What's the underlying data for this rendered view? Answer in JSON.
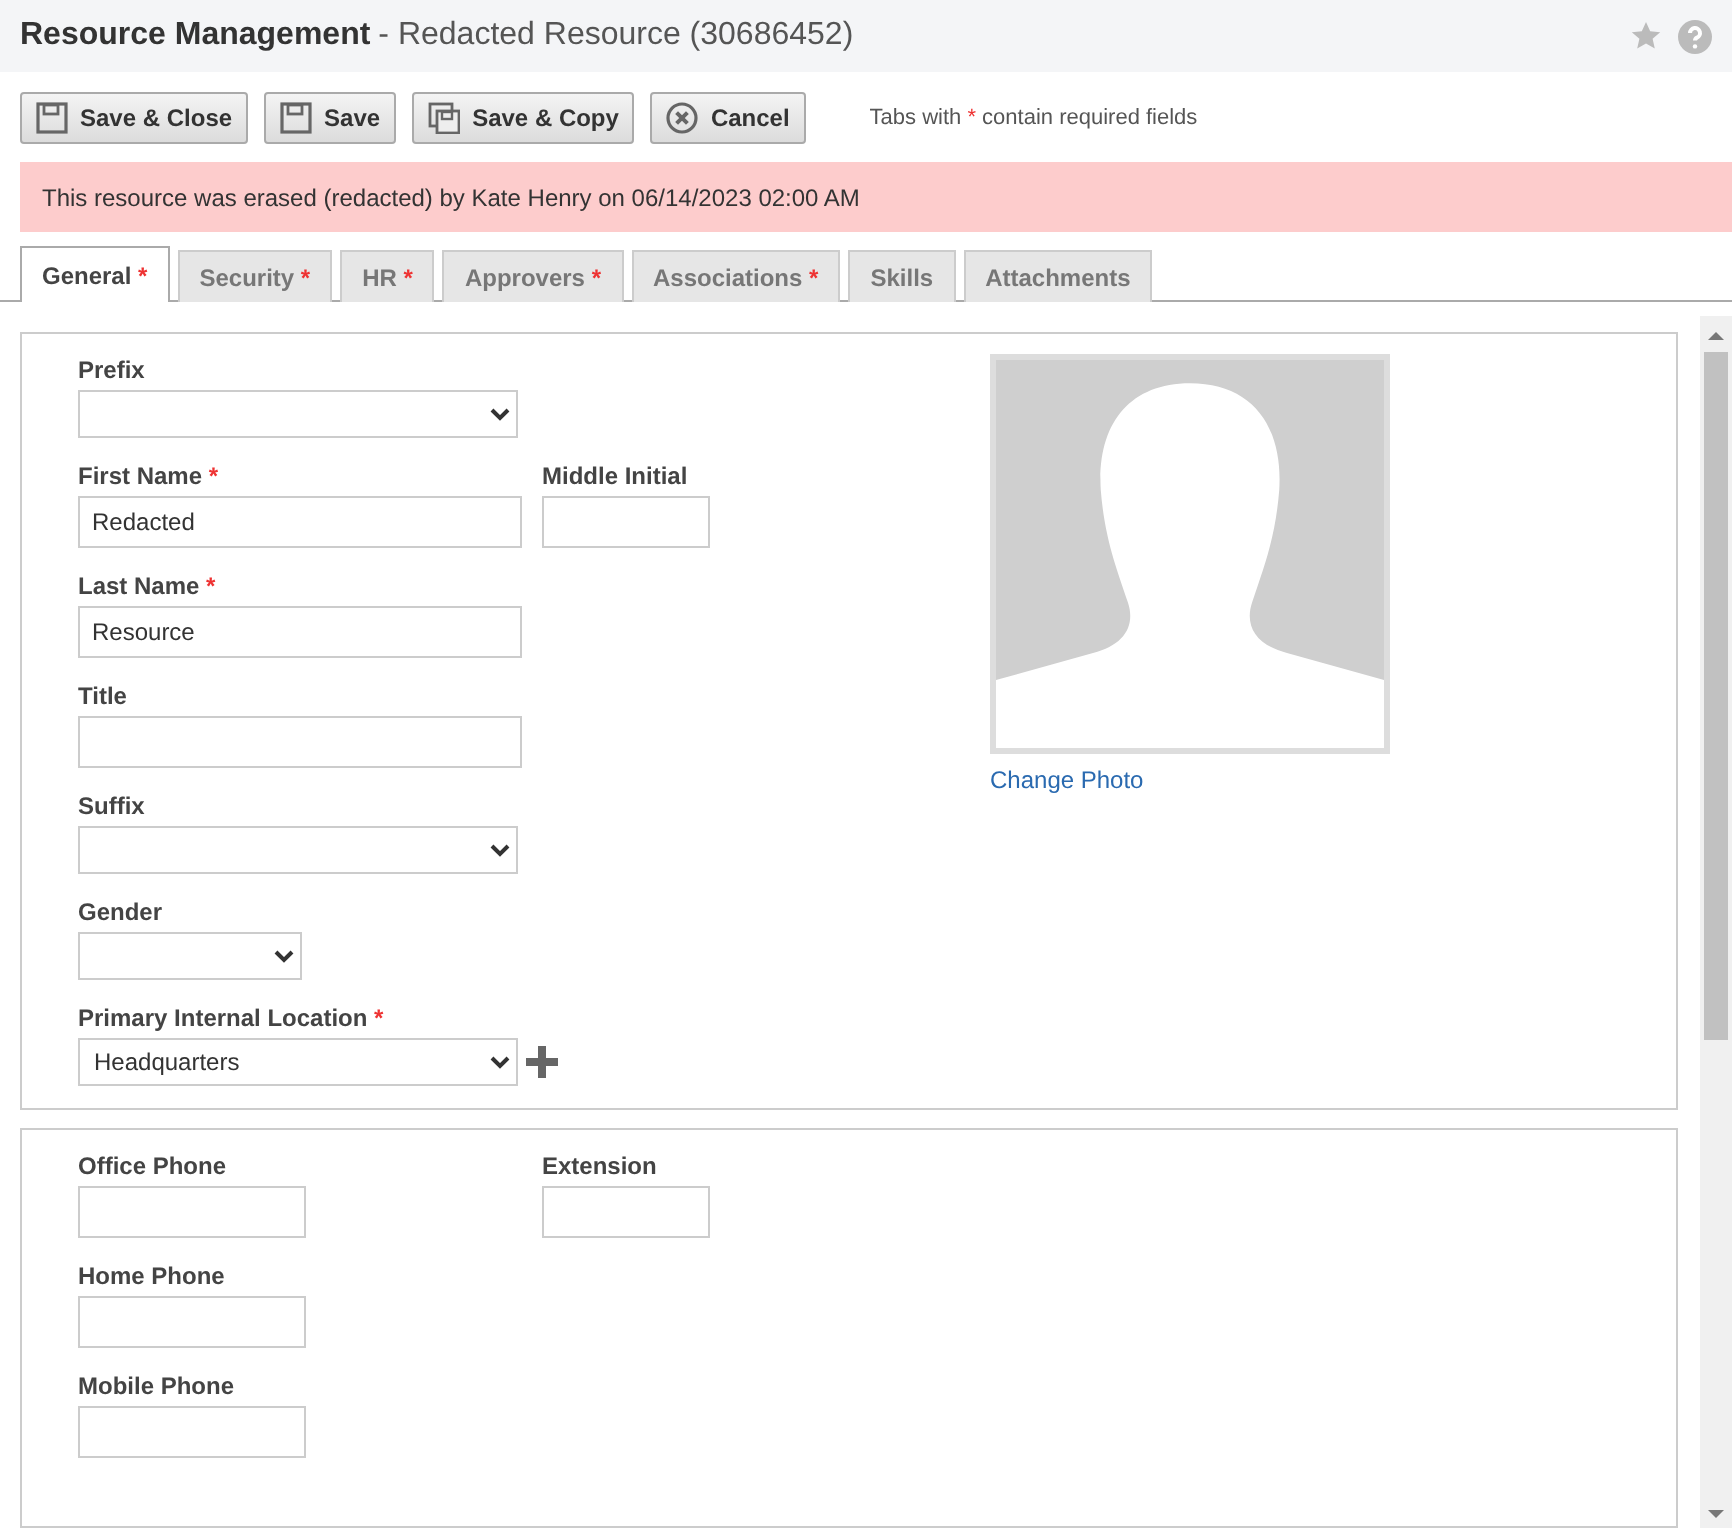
{
  "header": {
    "title": "Resource Management",
    "subtitle": "- Redacted Resource (30686452)"
  },
  "required_mark": "*",
  "toolbar": [
    {
      "label": "Save & Close",
      "kind": "save"
    },
    {
      "label": "Save",
      "kind": "save"
    },
    {
      "label": "Save & Copy",
      "kind": "copy"
    },
    {
      "label": "Cancel",
      "kind": "cancel"
    }
  ],
  "hint": {
    "before": "Tabs with",
    "after": "contain required fields"
  },
  "alert": "This resource was erased (redacted) by Kate Henry on 06/14/2023 02:00 AM",
  "tabs": [
    {
      "label": "General",
      "required": true,
      "selected": true
    },
    {
      "label": "Security",
      "required": true,
      "selected": false
    },
    {
      "label": "HR",
      "required": true,
      "selected": false
    },
    {
      "label": "Approvers",
      "required": true,
      "selected": false
    },
    {
      "label": "Associations",
      "required": true,
      "selected": false
    },
    {
      "label": "Skills",
      "required": false,
      "selected": false
    },
    {
      "label": "Attachments",
      "required": false,
      "selected": false
    }
  ],
  "panels": [
    {
      "photo_link": "Change Photo",
      "rows": [
        [
          {
            "label": "Prefix",
            "required": false,
            "kind": "select"
          }
        ],
        [
          {
            "label": "First Name",
            "required": true,
            "kind": "text",
            "value": "Redacted"
          },
          {
            "label": "Middle Initial",
            "required": false,
            "kind": "shorttext"
          }
        ],
        [
          {
            "label": "Last Name",
            "required": true,
            "kind": "text",
            "value": "Resource"
          }
        ],
        [
          {
            "label": "Title",
            "required": false,
            "kind": "text"
          }
        ],
        [
          {
            "label": "Suffix",
            "required": false,
            "kind": "select"
          }
        ],
        [
          {
            "label": "Gender",
            "required": false,
            "kind": "shortselect"
          }
        ],
        [
          {
            "label": "Primary Internal Location",
            "required": true,
            "kind": "select",
            "value": "Headquarters",
            "add_button": true
          }
        ]
      ]
    },
    {
      "rows": [
        [
          {
            "label": "Office Phone",
            "required": false,
            "kind": "mediumtext"
          },
          {
            "label": "Extension",
            "required": false,
            "kind": "shorttext"
          }
        ],
        [
          {
            "label": "Home Phone",
            "required": false,
            "kind": "mediumtext"
          }
        ],
        [
          {
            "label": "Mobile Phone",
            "required": false,
            "kind": "mediumtext"
          }
        ]
      ]
    }
  ]
}
